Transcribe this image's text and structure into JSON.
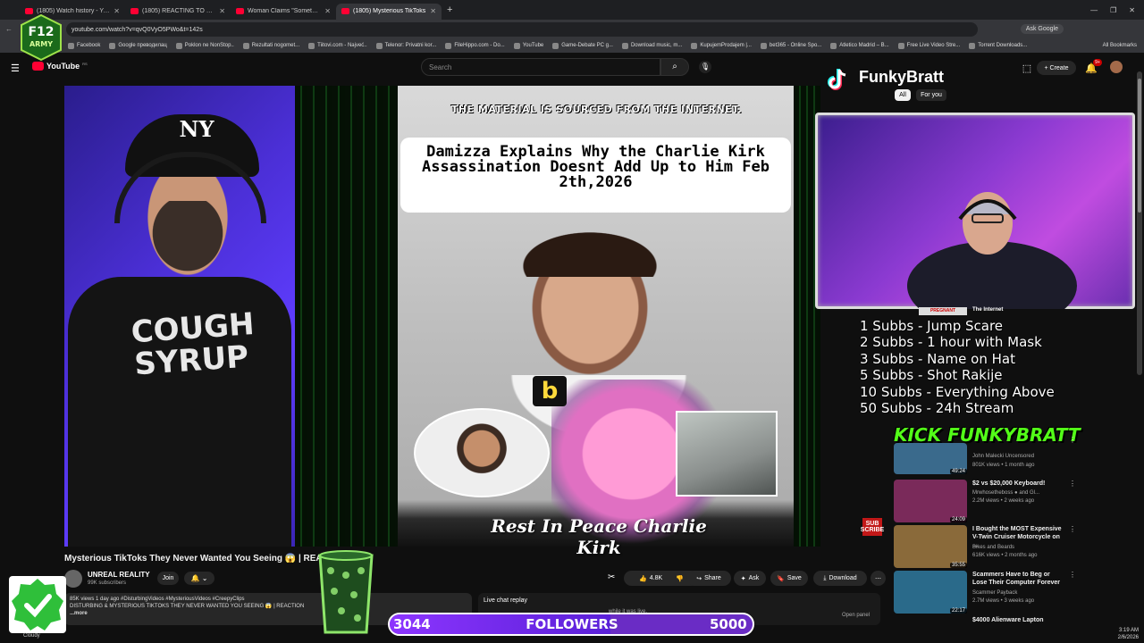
{
  "browser": {
    "tabs": [
      {
        "label": "(1805) Watch history - YouTube",
        "active": false
      },
      {
        "label": "(1805) REACTING TO UNEXPLAI",
        "active": false
      },
      {
        "label": "Woman Claims \"Something Sin",
        "active": false
      },
      {
        "label": "(1805) Mysterious TikToks",
        "active": true
      }
    ],
    "url": "youtube.com/watch?v=qvQ0VyO5PWo&t=142s",
    "ask_google": "Ask Google",
    "bookmarks": [
      "Facebook",
      "Google преводилац",
      "Poklon ne NonStop..",
      "Rezultati nogomet...",
      "Tiitovi.com - Najveć..",
      "Telenor: Privatni kor...",
      "FileHippo.com - Do...",
      "YouTube",
      "Game-Debate PC g...",
      "Download music, m...",
      "KupujemProdajem |...",
      "bet365 - Online Spo...",
      "Atletico Madrid – B...",
      "Free Live Video Stre...",
      "Torrent Downloads..."
    ],
    "all_bookmarks": "All Bookmarks"
  },
  "youtube": {
    "logo_text": "YouTube",
    "logo_country": "RS",
    "search_placeholder": "Search",
    "create_label": "Create",
    "notif_count": "9+"
  },
  "video": {
    "sourced_text": "THE MATERIAL IS SOURCED FROM THE INTERNET.",
    "headline": "Damizza Explains Why the Charlie Kirk Assassination Doesnt Add Up to Him Feb 2th,2026",
    "b_letter": "b",
    "rip_text": "Rest In Peace Charlie Kirk",
    "tshirt_text": "COUGH SYRUP",
    "cap_logo": "NY",
    "sub_badge": "SUB SCRIBE",
    "title": "Mysterious TikToks They Never Wanted You Seeing 😱 | REACT",
    "channel": "UNREAL REALITY",
    "subs": "99K subscribers",
    "join": "Join",
    "bell": "🔔 ⌄",
    "likes": "4.8K",
    "share": "Share",
    "ask": "Ask",
    "save": "Save",
    "download": "Download",
    "desc_line1": "85K views  1 day ago  #DisturbingVideos #MysteriousVideos #CreepyClips",
    "desc_line2": "DISTURBING & MYSTERIOUS TIKTOKS THEY NEVER WANTED YOU SEEING 😱 | REACTION",
    "desc_more": "...more",
    "live_chat": "Live chat replay",
    "live_chat_msg": "while it was live.",
    "open_panel": "Open panel"
  },
  "stream": {
    "streamer": "FunkyBratt",
    "chip_all": "All",
    "chip_foryou": "For you",
    "goals": [
      "1 Subbs - Jump Scare",
      "2 Subbs - 1 hour with Mask",
      "3 Subbs - Name on Hat",
      "5 Subbs - Shot Rakije",
      "10 Subbs - Everything Above",
      "50 Subbs - 24h Stream"
    ],
    "kick_text": "KICK FUNKYBRATT",
    "followers_current": "3044",
    "followers_label": "FOLLOWERS",
    "followers_goal": "5000",
    "followers_progress": 0.6088,
    "f12_text": "F12 ARMY",
    "weather": "Cloudy",
    "clock": "3:19 AM",
    "date": "2/6/2026"
  },
  "sidebar": {
    "top_label": "PREGNANT",
    "top_title": "The Internet",
    "recommendations": [
      {
        "title": "",
        "channel": "John Malecki Uncensored",
        "views": "801K views • 1 month ago",
        "duration": "49:24",
        "color": "#3a6a8c"
      },
      {
        "title": "$2 vs $20,000 Keyboard!",
        "channel": "Mrwhosetheboss ● and Gl...",
        "views": "2.2M views • 2 weeks ago",
        "duration": "24:09",
        "color": "#7a2a5a"
      },
      {
        "title": "I Bought the MOST Expensive V-Twin Cruiser Motorcycle on ...",
        "channel": "Bikes and Beards",
        "views": "616K views • 2 months ago",
        "duration": "35:55",
        "color": "#8a6a3a"
      },
      {
        "title": "Scammers Have to Beg or Lose Their Computer Forever",
        "channel": "Scammer Payback",
        "views": "2.7M views • 3 weeks ago",
        "duration": "22:17",
        "color": "#2a6a8a"
      },
      {
        "title": "$4000 Alienware Lapton",
        "channel": "",
        "views": "",
        "duration": "",
        "color": "#333"
      }
    ]
  }
}
